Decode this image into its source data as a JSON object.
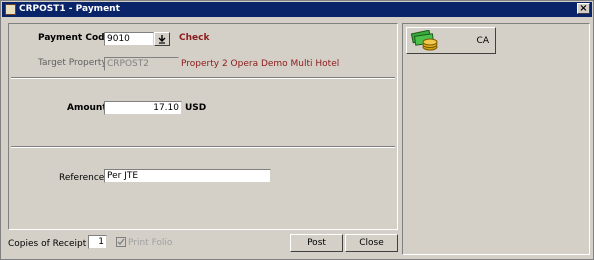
{
  "window": {
    "title": "CRPOST1 - Payment",
    "close_glyph": "×"
  },
  "form": {
    "payment_code_label": "Payment Code",
    "payment_code_value": "9010",
    "payment_code_desc": "Check",
    "target_property_label": "Target Property",
    "target_property_value": "CRPOST2",
    "target_property_desc": "Property 2 Opera Demo Multi Hotel",
    "amount_label": "Amount",
    "amount_value": "17.10",
    "currency": "USD",
    "reference_label": "Reference",
    "reference_value": "Per JTE"
  },
  "footer": {
    "copies_label": "Copies of Receipt",
    "copies_value": "1",
    "print_folio_label": "Print Folio",
    "post_label": "Post",
    "close_label": "Close"
  },
  "side": {
    "ca_label": "CA",
    "icon": "money-icon"
  }
}
